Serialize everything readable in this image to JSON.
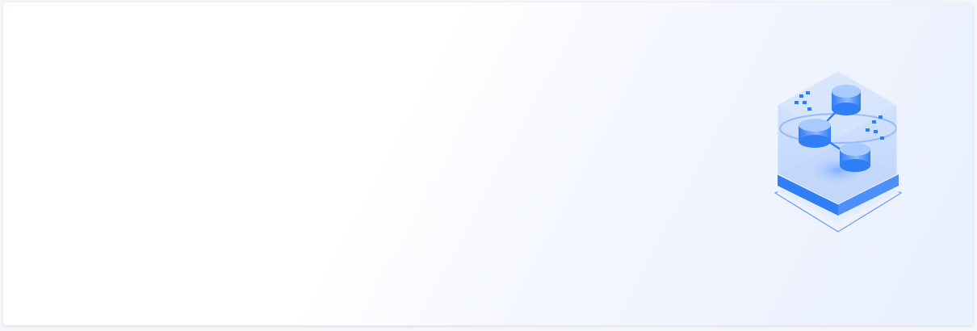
{
  "banner": {
    "illustration_icon": "data-network-cube-icon",
    "colors": {
      "accent": "#2f7ef5",
      "accent_light": "#9cc3ff",
      "panel_glass": "#c9dcfb",
      "background_tint": "#e8effd"
    }
  }
}
